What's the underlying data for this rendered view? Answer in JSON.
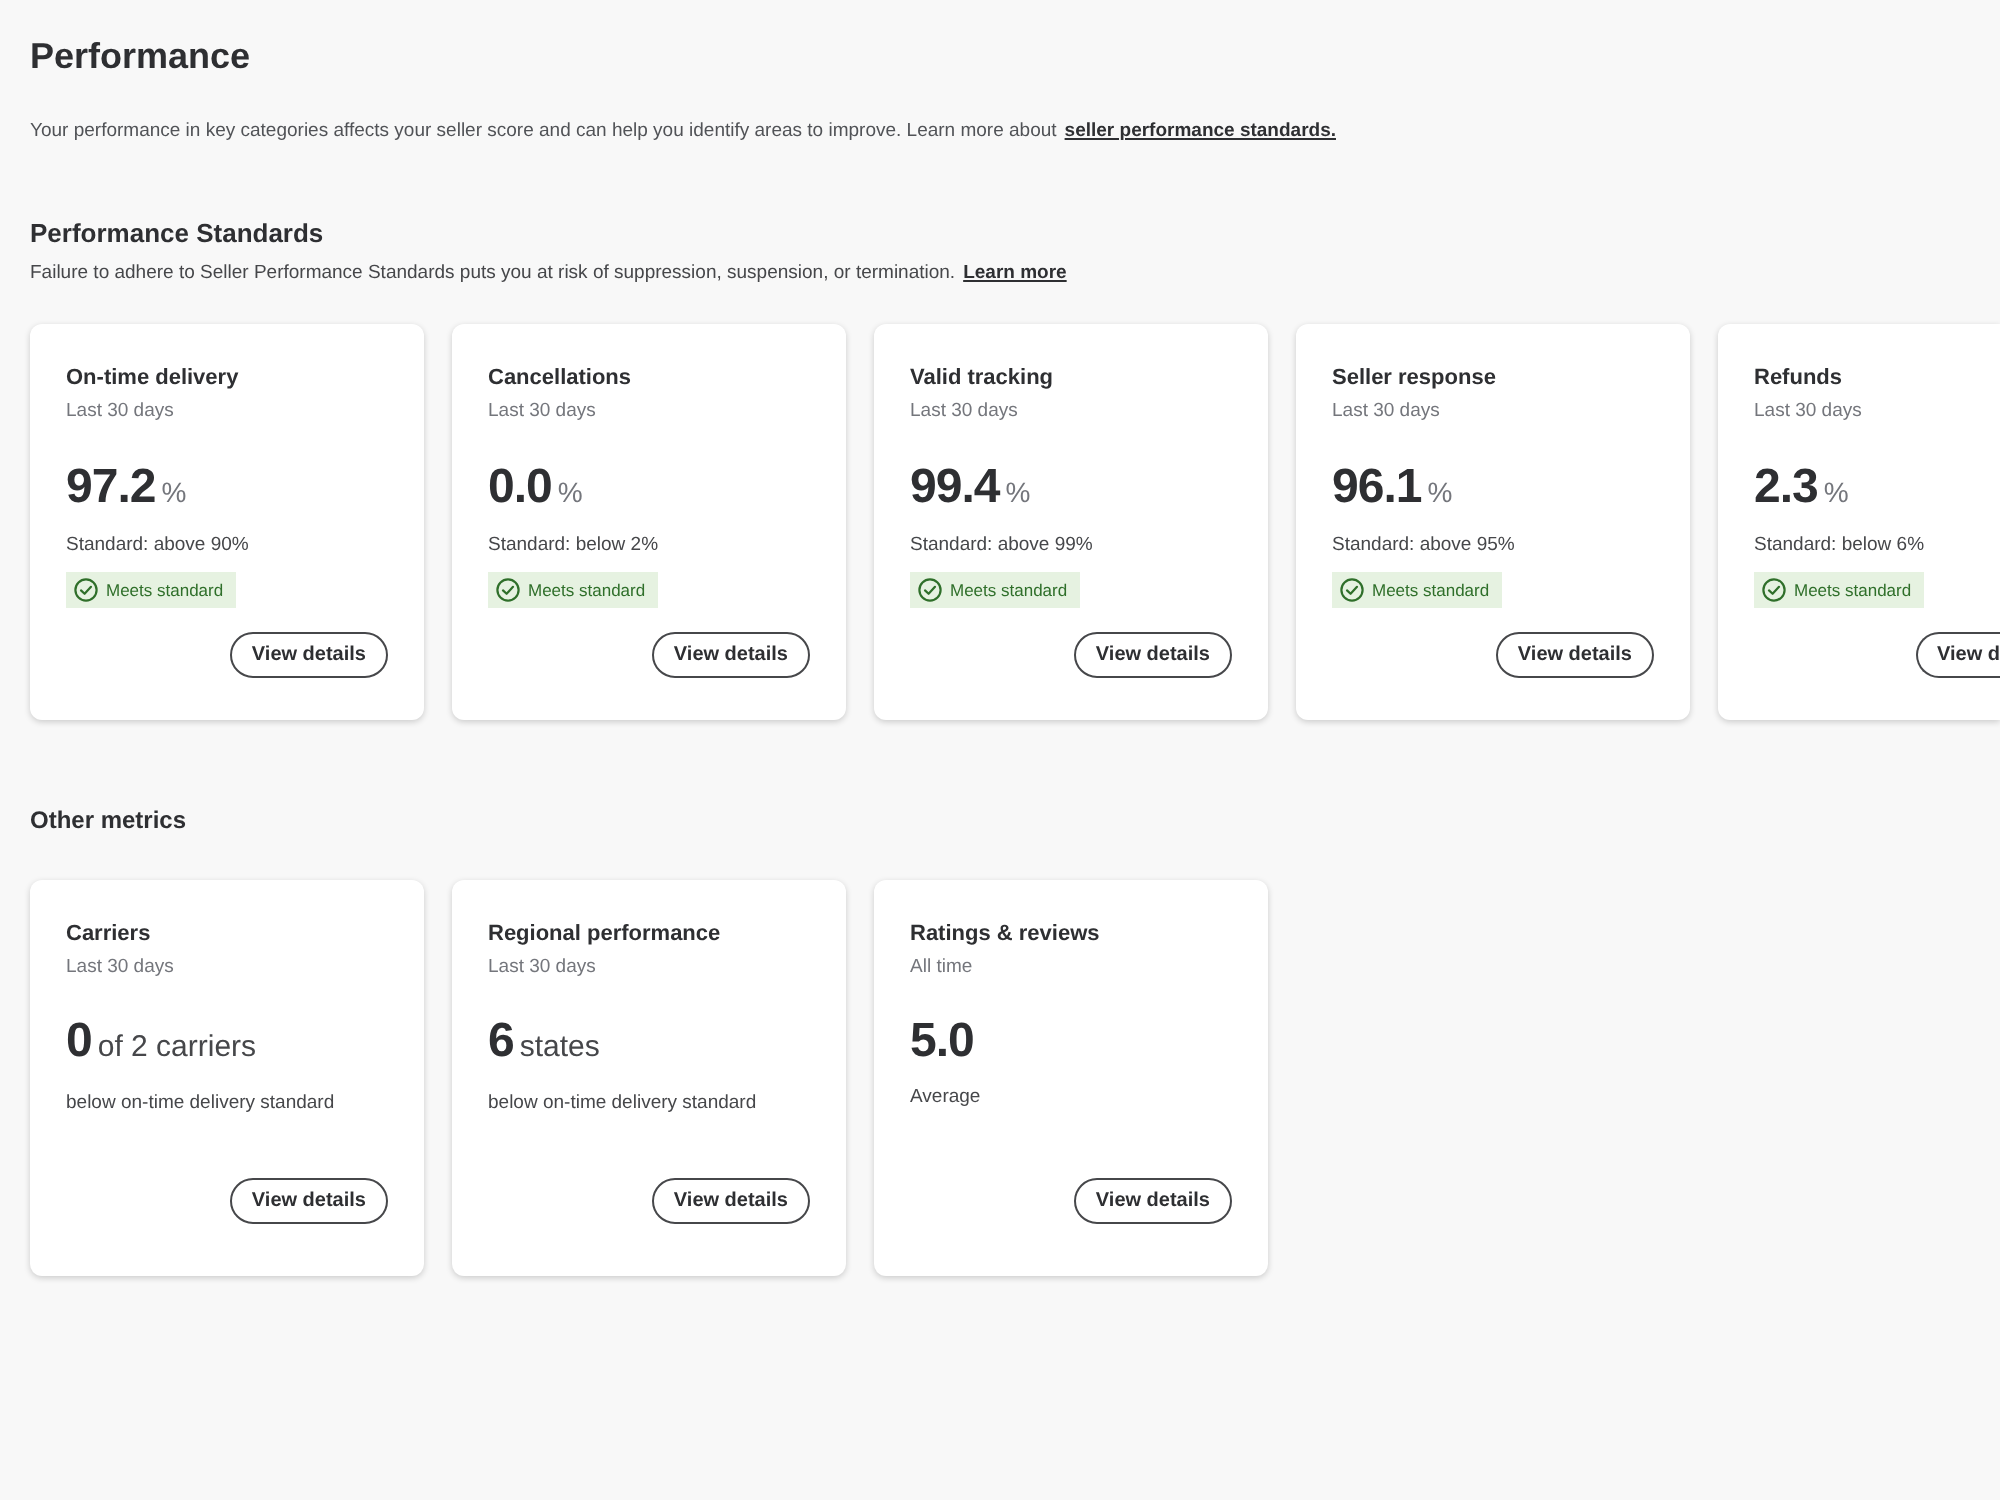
{
  "page": {
    "title": "Performance",
    "intro": {
      "text": "Your performance in key categories affects your seller score and can help you identify areas to improve. Learn more about",
      "link": "seller performance standards."
    }
  },
  "standards": {
    "heading": "Performance Standards",
    "description": {
      "text": "Failure to adhere to Seller Performance Standards puts you at risk of suppression, suspension, or termination.",
      "link": "Learn more"
    },
    "cards": [
      {
        "title": "On-time delivery",
        "period": "Last 30 days",
        "value": "97.2",
        "unit": "%",
        "standard": "Standard: above 90%",
        "status": {
          "label": "Meets standard",
          "kind": "meets"
        },
        "button": "View details"
      },
      {
        "title": "Cancellations",
        "period": "Last 30 days",
        "value": "0.0",
        "unit": "%",
        "standard": "Standard: below 2%",
        "status": {
          "label": "Meets standard",
          "kind": "meets"
        },
        "button": "View details"
      },
      {
        "title": "Valid tracking",
        "period": "Last 30 days",
        "value": "99.4",
        "unit": "%",
        "standard": "Standard: above 99%",
        "status": {
          "label": "Meets standard",
          "kind": "meets"
        },
        "button": "View details"
      },
      {
        "title": "Seller response",
        "period": "Last 30 days",
        "value": "96.1",
        "unit": "%",
        "standard": "Standard: above 95%",
        "status": {
          "label": "Meets standard",
          "kind": "meets"
        },
        "button": "View details"
      },
      {
        "title": "Refunds",
        "period": "Last 30 days",
        "value": "2.3",
        "unit": "%",
        "standard": "Standard: below 6%",
        "status": {
          "label": "Meets standard",
          "kind": "meets"
        },
        "button": "View d"
      }
    ]
  },
  "other_metrics": {
    "heading": "Other metrics",
    "cards": [
      {
        "title": "Carriers",
        "period": "Last 30 days",
        "value": "0",
        "unit": "of 2 carriers",
        "note": "below on-time delivery standard",
        "button": "View details"
      },
      {
        "title": "Regional performance",
        "period": "Last 30 days",
        "value": "6",
        "unit": "states",
        "note": "below on-time delivery standard",
        "button": "View details"
      },
      {
        "title": "Ratings & reviews",
        "period": "All time",
        "value": "5.0",
        "note": "Average",
        "button": "View details"
      }
    ]
  }
}
